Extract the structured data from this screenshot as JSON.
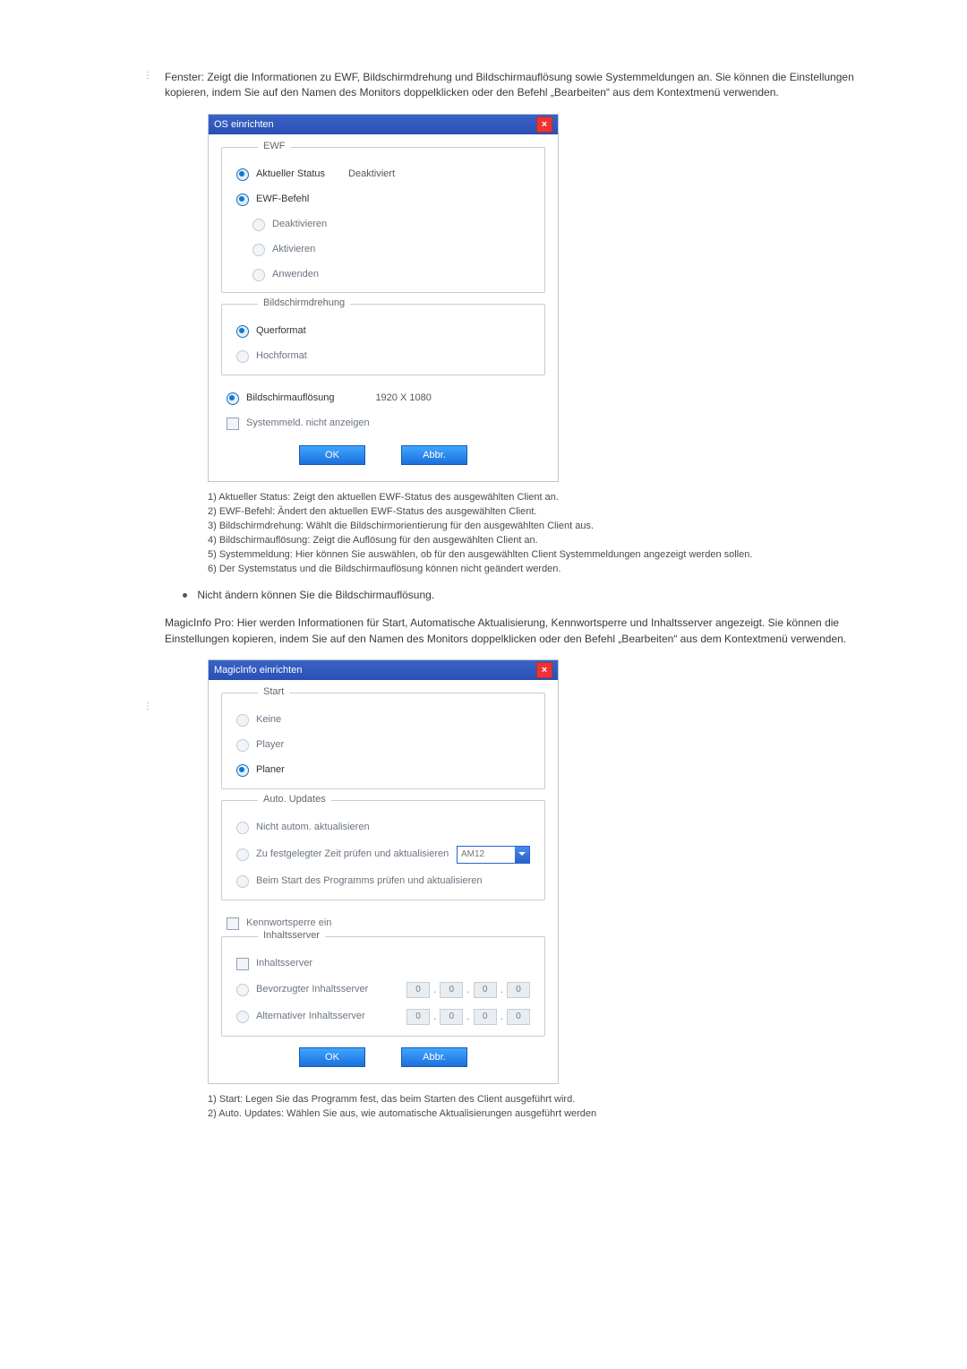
{
  "intro1": "Fenster: Zeigt die Informationen zu EWF, Bildschirmdrehung und Bildschirmauflösung sowie Systemmeldungen an. Sie können die Einstellungen kopieren, indem Sie auf den Namen des Monitors doppelklicken oder den Befehl „Bearbeiten“ aus dem Kontextmenü verwenden.",
  "dlg1": {
    "title": "OS einrichten",
    "ewf": {
      "legend": "EWF",
      "current_label": "Aktueller Status",
      "current_value": "Deaktiviert",
      "cmd_label": "EWF-Befehl",
      "cmd_deactivate": "Deaktivieren",
      "cmd_activate": "Aktivieren",
      "cmd_apply": "Anwenden"
    },
    "rot": {
      "legend": "Bildschirmdrehung",
      "landscape": "Querformat",
      "portrait": "Hochformat"
    },
    "res_label": "Bildschirmauflösung",
    "res_value": "1920 X 1080",
    "sysmsg": "Systemmeld. nicht anzeigen",
    "ok": "OK",
    "cancel": "Abbr."
  },
  "notes1": [
    "1) Aktueller Status: Zeigt den aktuellen EWF-Status des ausgewählten Client an.",
    "2) EWF-Befehl: Ändert den aktuellen EWF-Status des ausgewählten Client.",
    "3) Bildschirmdrehung: Wählt die Bildschirmorientierung für den ausgewählten Client aus.",
    "4) Bildschirmauflösung: Zeigt die Auflösung für den ausgewählten Client an.",
    "5) Systemmeldung: Hier können Sie auswählen, ob für den ausgewählten Client Systemmeldungen angezeigt werden sollen.",
    "6) Der Systemstatus und die Bildschirmauflösung können nicht geändert werden."
  ],
  "bullet1": "Nicht ändern können Sie die Bildschirmauflösung.",
  "intro2": "MagicInfo Pro: Hier werden Informationen für Start, Automatische Aktualisierung, Kennwortsperre und Inhaltsserver angezeigt. Sie können die Einstellungen kopieren, indem Sie auf den Namen des Monitors doppelklicken oder den Befehl „Bearbeiten“ aus dem Kontextmenü verwenden.",
  "dlg2": {
    "title": "MagicInfo einrichten",
    "start": {
      "legend": "Start",
      "none": "Keine",
      "player": "Player",
      "planner": "Planer"
    },
    "auto": {
      "legend": "Auto. Updates",
      "no_auto": "Nicht autom. aktualisieren",
      "at_time": "Zu festgelegter Zeit prüfen und aktualisieren",
      "time_value": "AM12",
      "on_start": "Beim Start des Programms prüfen und aktualisieren"
    },
    "pwlock": "Kennwortsperre ein",
    "cs": {
      "legend": "Inhaltsserver",
      "enable": "Inhaltsserver",
      "preferred": "Bevorzugter Inhaltsserver",
      "alternate": "Alternativer Inhaltsserver",
      "ip": [
        "0",
        "0",
        "0",
        "0"
      ]
    },
    "ok": "OK",
    "cancel": "Abbr."
  },
  "notes2": [
    "1) Start: Legen Sie das Programm fest, das beim Starten des Client ausgeführt wird.",
    "2) Auto. Updates: Wählen Sie aus, wie automatische Aktualisierungen ausgeführt werden"
  ]
}
